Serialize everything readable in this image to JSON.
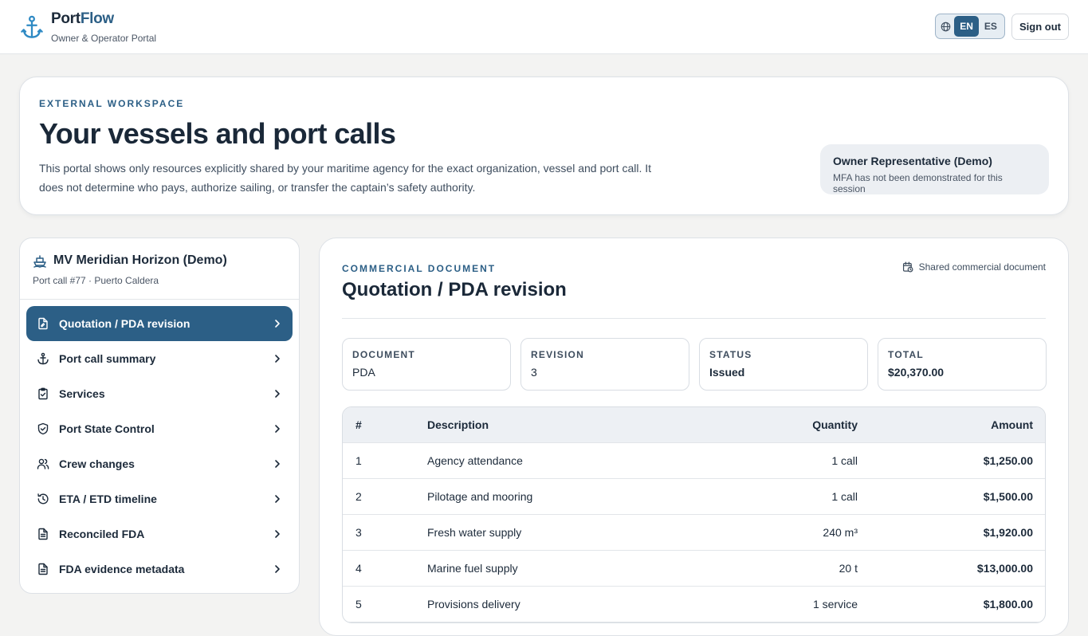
{
  "app": {
    "name_part1": "Port",
    "name_part2": "Flow",
    "subtitle": "Owner & Operator Portal"
  },
  "header": {
    "languages": [
      {
        "code": "EN",
        "active": true
      },
      {
        "code": "ES",
        "active": false
      }
    ],
    "sign_out_label": "Sign out"
  },
  "hero": {
    "eyebrow": "EXTERNAL WORKSPACE",
    "title": "Your vessels and port calls",
    "description": "This portal shows only resources explicitly shared by your maritime agency for the exact organization, vessel and port call. It does not determine who pays, authorize sailing, or transfer the captain’s safety authority.",
    "role_title": "Owner Representative (Demo)",
    "role_note": "MFA has not been demonstrated for this session"
  },
  "sidebar": {
    "vessel_name": "MV Meridian Horizon (Demo)",
    "port_call": "Port call #77 · Puerto Caldera",
    "items": [
      {
        "label": "Quotation / PDA revision",
        "icon": "document-edit-icon",
        "active": true
      },
      {
        "label": "Port call summary",
        "icon": "anchor-icon",
        "active": false
      },
      {
        "label": "Services",
        "icon": "clipboard-check-icon",
        "active": false
      },
      {
        "label": "Port State Control",
        "icon": "shield-check-icon",
        "active": false
      },
      {
        "label": "Crew changes",
        "icon": "users-icon",
        "active": false
      },
      {
        "label": "ETA / ETD timeline",
        "icon": "history-icon",
        "active": false
      },
      {
        "label": "Reconciled FDA",
        "icon": "document-text-icon",
        "active": false
      },
      {
        "label": "FDA evidence metadata",
        "icon": "document-text-icon",
        "active": false
      }
    ]
  },
  "main": {
    "eyebrow": "COMMERCIAL DOCUMENT",
    "title": "Quotation / PDA revision",
    "shared_label": "Shared commercial document",
    "cards": [
      {
        "key": "DOCUMENT",
        "value": "PDA"
      },
      {
        "key": "REVISION",
        "value": "3"
      },
      {
        "key": "STATUS",
        "value": "Issued"
      },
      {
        "key": "TOTAL",
        "value": "$20,370.00"
      }
    ],
    "table": {
      "headers": {
        "num": "#",
        "desc": "Description",
        "qty": "Quantity",
        "amt": "Amount"
      },
      "rows": [
        {
          "num": "1",
          "desc": "Agency attendance",
          "qty": "1 call",
          "amt": "$1,250.00"
        },
        {
          "num": "2",
          "desc": "Pilotage and mooring",
          "qty": "1 call",
          "amt": "$1,500.00"
        },
        {
          "num": "3",
          "desc": "Fresh water supply",
          "qty": "240 m³",
          "amt": "$1,920.00"
        },
        {
          "num": "4",
          "desc": "Marine fuel supply",
          "qty": "20 t",
          "amt": "$13,000.00"
        },
        {
          "num": "5",
          "desc": "Provisions delivery",
          "qty": "1 service",
          "amt": "$1,800.00"
        }
      ]
    }
  },
  "colors": {
    "accent": "#2c5f86",
    "text": "#1c2a3a",
    "background": "#f3f3f2"
  }
}
